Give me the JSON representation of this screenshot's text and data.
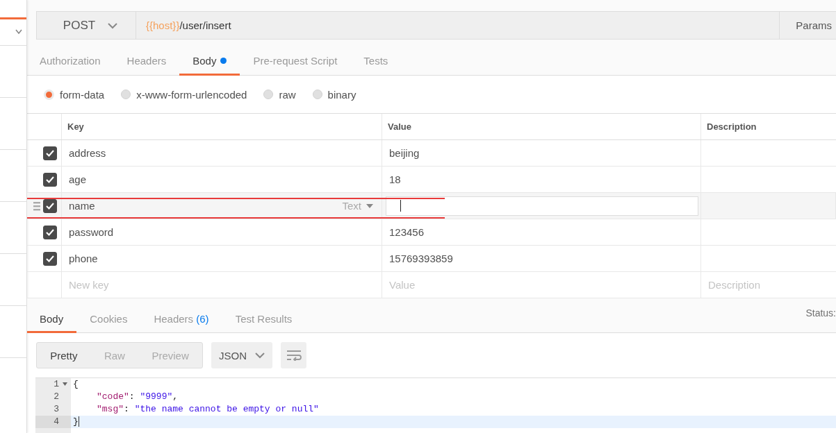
{
  "request": {
    "method": "POST",
    "url": [
      {
        "kind": "variable",
        "text": "{{host}}"
      },
      {
        "kind": "path",
        "text": "/user/insert"
      }
    ],
    "params_button": "Params"
  },
  "tabs": [
    {
      "label": "Authorization",
      "selected": false,
      "dot": false
    },
    {
      "label": "Headers",
      "selected": false,
      "dot": false
    },
    {
      "label": "Body",
      "selected": true,
      "dot": true
    },
    {
      "label": "Pre-request Script",
      "selected": false,
      "dot": false
    },
    {
      "label": "Tests",
      "selected": false,
      "dot": false
    }
  ],
  "body_modes": [
    {
      "label": "form-data",
      "selected": true
    },
    {
      "label": "x-www-form-urlencoded",
      "selected": false
    },
    {
      "label": "raw",
      "selected": false
    },
    {
      "label": "binary",
      "selected": false
    }
  ],
  "params": {
    "columns": [
      "Key",
      "Value",
      "Description"
    ],
    "rows": [
      {
        "key": "address",
        "value": "beijing",
        "checked": true,
        "hovered": false,
        "editing": false,
        "highlighted": false
      },
      {
        "key": "age",
        "value": "18",
        "checked": true,
        "hovered": false,
        "editing": false,
        "highlighted": false
      },
      {
        "key": "name",
        "type_label": "Text",
        "checked": true,
        "hovered": true,
        "editing": true,
        "highlighted": true
      },
      {
        "key": "password",
        "value": "123456",
        "checked": true,
        "hovered": false,
        "editing": false,
        "highlighted": false
      },
      {
        "key": "phone",
        "value": "15769393859",
        "checked": true,
        "hovered": false,
        "editing": false,
        "highlighted": false
      }
    ],
    "new_row": {
      "key_placeholder": "New key",
      "value_placeholder": "Value",
      "description_placeholder": "Description"
    }
  },
  "response": {
    "tabs": [
      {
        "label": "Body",
        "selected": true
      },
      {
        "label": "Cookies",
        "selected": false
      },
      {
        "label": "Headers",
        "count": "(6)",
        "selected": false
      },
      {
        "label": "Test Results",
        "selected": false
      }
    ],
    "status_label": "Status:",
    "view_modes": [
      {
        "label": "Pretty",
        "selected": true
      },
      {
        "label": "Raw",
        "selected": false
      },
      {
        "label": "Preview",
        "selected": false
      }
    ],
    "format": "JSON",
    "code": [
      {
        "number": "1",
        "fold": true,
        "current": false,
        "tokens": [
          {
            "kind": "punct",
            "text": "{"
          }
        ],
        "children": [
          {
            "number": "2",
            "fold": false,
            "current": false,
            "tokens": [
              {
                "kind": "key",
                "text": "\"code\""
              },
              {
                "kind": "punct",
                "text": ": "
              },
              {
                "kind": "string",
                "text": "\"9999\""
              },
              {
                "kind": "punct",
                "text": ","
              }
            ]
          },
          {
            "number": "3",
            "fold": false,
            "current": false,
            "tokens": [
              {
                "kind": "key",
                "text": "\"msg\""
              },
              {
                "kind": "punct",
                "text": ": "
              },
              {
                "kind": "string",
                "text": "\"the name cannot be empty or null\""
              }
            ]
          }
        ]
      },
      {
        "number": "4",
        "fold": false,
        "current": true,
        "tokens": [
          {
            "kind": "punct",
            "text": "}"
          }
        ]
      }
    ]
  }
}
